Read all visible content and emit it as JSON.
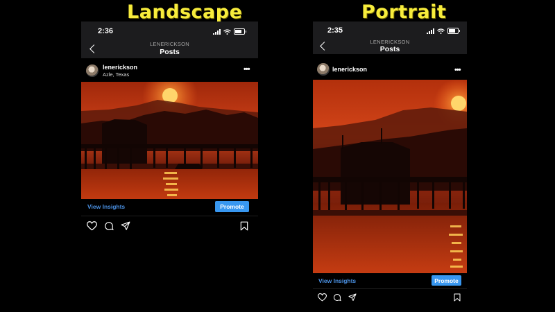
{
  "labels": {
    "landscape": "Landscape",
    "portrait": "Portrait"
  },
  "phones": [
    {
      "time": "2:36",
      "nav_subtitle": "LENERICKSON",
      "nav_title": "Posts",
      "username": "lenerickson",
      "location": "Azle, Texas",
      "insights_label": "View Insights",
      "promote_label": "Promote"
    },
    {
      "time": "2:35",
      "nav_subtitle": "LENERICKSON",
      "nav_title": "Posts",
      "username": "lenerickson",
      "insights_label": "View Insights",
      "promote_label": "Promote"
    }
  ],
  "colors": {
    "caption": "#f7ec3c",
    "link": "#4a90e2",
    "button": "#3897f0",
    "header": "#1c1c1e"
  }
}
